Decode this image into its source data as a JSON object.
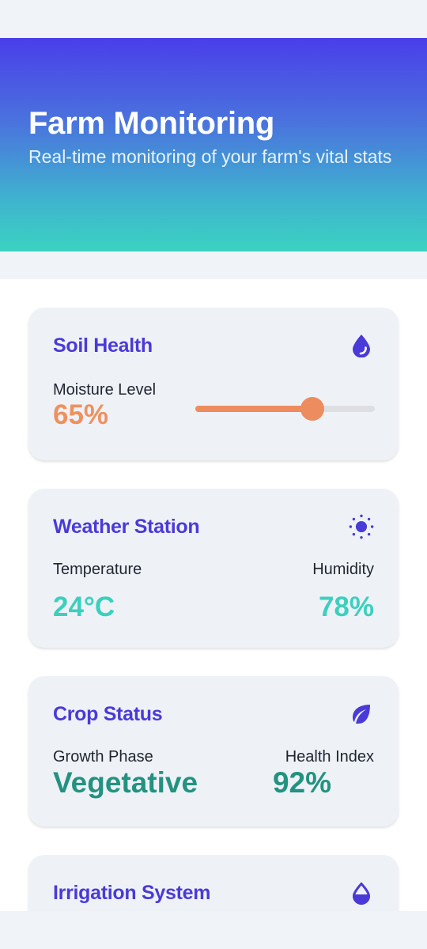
{
  "header": {
    "title": "Farm Monitoring",
    "subtitle": "Real-time monitoring of your farm's vital stats"
  },
  "colors": {
    "accent": "#4a3ad8",
    "orange": "#ed8c5e",
    "teal": "#3ccfbe",
    "green": "#239280"
  },
  "cards": {
    "soil": {
      "title": "Soil Health",
      "icon": "water-drop-icon",
      "moisture_label": "Moisture Level",
      "moisture_value": "65%",
      "moisture_fraction": 0.65
    },
    "weather": {
      "title": "Weather Station",
      "icon": "sun-icon",
      "temperature_label": "Temperature",
      "temperature_value": "24°C",
      "humidity_label": "Humidity",
      "humidity_value": "78%"
    },
    "crop": {
      "title": "Crop Status",
      "icon": "leaf-icon",
      "growth_label": "Growth Phase",
      "growth_value": "Vegetative",
      "health_label": "Health Index",
      "health_value": "92%"
    },
    "irrigation": {
      "title": "Irrigation System",
      "icon": "half-drop-icon"
    }
  }
}
